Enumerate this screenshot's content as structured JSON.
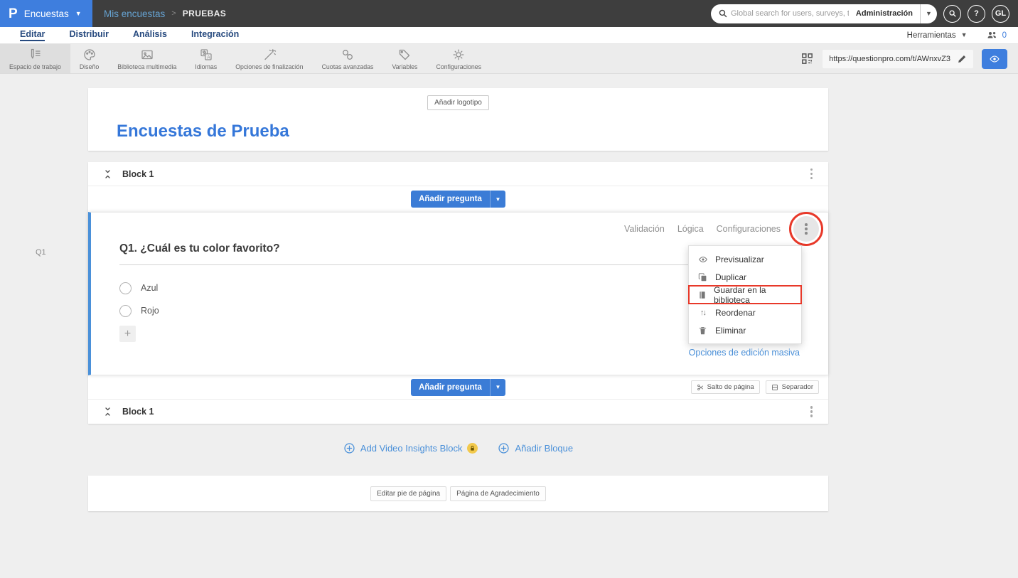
{
  "topbar": {
    "product": "Encuestas",
    "breadcrumb": {
      "parent": "Mis encuestas",
      "separator": ">",
      "current": "PRUEBAS"
    },
    "search_placeholder": "Global search for users, surveys, tickets",
    "admin_label": "Administración",
    "avatar": "GL"
  },
  "nav": {
    "tabs": [
      {
        "label": "Editar",
        "active": true
      },
      {
        "label": "Distribuir",
        "active": false
      },
      {
        "label": "Análisis",
        "active": false
      },
      {
        "label": "Integración",
        "active": false
      }
    ],
    "tools_label": "Herramientas",
    "collaborators_count": "0"
  },
  "toolbar": {
    "items": [
      {
        "label": "Espacio de trabajo",
        "icon": "workspace-icon",
        "active": true
      },
      {
        "label": "Diseño",
        "icon": "palette-icon",
        "active": false
      },
      {
        "label": "Biblioteca multimedia",
        "icon": "image-icon",
        "active": false
      },
      {
        "label": "Idiomas",
        "icon": "translate-icon",
        "active": false
      },
      {
        "label": "Opciones de finalización",
        "icon": "wand-icon",
        "active": false
      },
      {
        "label": "Cuotas avanzadas",
        "icon": "chain-links-icon",
        "active": false
      },
      {
        "label": "Variables",
        "icon": "tag-icon",
        "active": false
      },
      {
        "label": "Configuraciones",
        "icon": "gear-icon",
        "active": false
      }
    ],
    "survey_url": "https://questionpro.com/t/AWnxvZ3"
  },
  "survey": {
    "add_logo_label": "Añadir logotipo",
    "title": "Encuestas de Prueba"
  },
  "blocks": {
    "block1_label": "Block 1",
    "block2_label": "Block 1",
    "add_question_label": "Añadir pregunta"
  },
  "question": {
    "side_label": "Q1",
    "text": "Q1. ¿Cuál es tu color favorito?",
    "options": [
      "Azul",
      "Rojo"
    ],
    "links": [
      "Validación",
      "Lógica",
      "Configuraciones"
    ],
    "bulk_edit_label": "Opciones de edición masiva"
  },
  "context_menu": {
    "items": [
      {
        "label": "Previsualizar",
        "icon": "eye-icon",
        "highlighted": false
      },
      {
        "label": "Duplicar",
        "icon": "duplicate-icon",
        "highlighted": false
      },
      {
        "label": "Guardar en la biblioteca",
        "icon": "library-icon",
        "highlighted": true
      },
      {
        "label": "Reordenar",
        "icon": "reorder-icon",
        "highlighted": false
      },
      {
        "label": "Eliminar",
        "icon": "trash-icon",
        "highlighted": false
      }
    ]
  },
  "page_controls": {
    "page_break_label": "Salto de página",
    "separator_label": "Separador"
  },
  "add_section": {
    "video_block_label": "Add Video Insights Block",
    "add_block_label": "Añadir Bloque"
  },
  "footer": {
    "edit_footer_label": "Editar pie de página",
    "thanks_page_label": "Página de Agradecimiento"
  },
  "colors": {
    "accent_blue": "#3b7cd6",
    "logo_blue": "#3e7ede",
    "link_blue": "#4a90d9",
    "title_blue": "#3577d9",
    "annotation_red": "#e8392a",
    "topbar_gray": "#3e3e3e",
    "premium_yellow": "#f2c94c"
  }
}
